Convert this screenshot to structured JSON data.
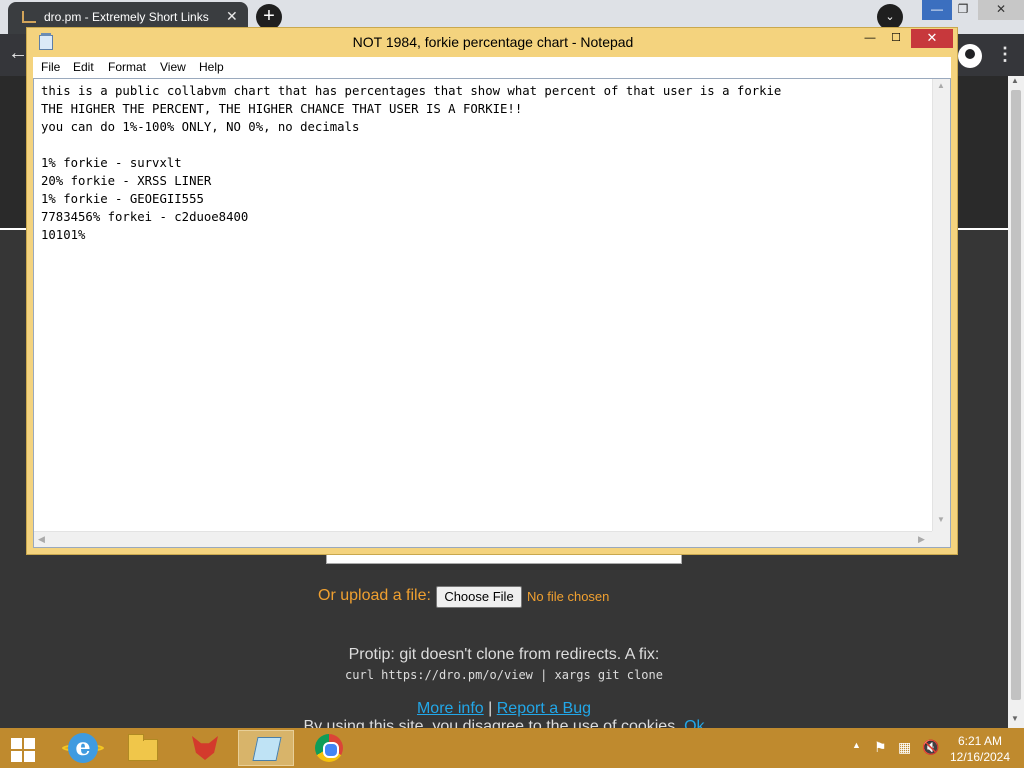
{
  "browser": {
    "tab_title": "dro.pm - Extremely Short Links",
    "tab_close": "✕",
    "new_tab": "+",
    "tab_search": "⌄",
    "minimize": "—",
    "restore": "❐",
    "close": "✕",
    "back": "←",
    "menu": "⋮"
  },
  "page": {
    "upload_label": "Or upload a file:",
    "choose_file": "Choose File",
    "no_file": "No file chosen",
    "protip": "Protip: git doesn't clone from redirects. A fix:",
    "protip_code": "curl https://dro.pm/o/view | xargs git clone",
    "more_info": "More info",
    "separator": "|",
    "report_bug": "Report a Bug",
    "cookie_text": "By using this site, you disagree to the use of cookies.",
    "cookie_ok": "Ok"
  },
  "notepad": {
    "title": "NOT 1984, forkie percentage chart - Notepad",
    "minimize": "—",
    "maximize": "☐",
    "close": "✕",
    "menu": [
      "File",
      "Edit",
      "Format",
      "View",
      "Help"
    ],
    "content": "this is a public collabvm chart that has percentages that show what percent of that user is a forkie\nTHE HIGHER THE PERCENT, THE HIGHER CHANCE THAT USER IS A FORKIE!!\nyou can do 1%-100% ONLY, NO 0%, no decimals\n\n1% forkie - survxlt\n20% forkie - XRSS LINER\n1% forkie - GEOEGII555\n7783456% forkei - c2duoe8400\n10101%"
  },
  "taskbar": {
    "clock_time": "6:21 AM",
    "clock_date": "12/16/2024",
    "tray_chevron": "▲"
  },
  "icons": {
    "browser_favicon": "dro-pm-favicon",
    "start": "windows-logo-icon",
    "ie": "internet-explorer-icon",
    "explorer": "file-explorer-icon",
    "fox": "red-fox-app-icon",
    "notepad": "notepad-icon",
    "chrome": "chrome-icon"
  },
  "colors": {
    "taskbar": "#bf8a2e",
    "notepad_frame": "#f4d37e",
    "accent_orange": "#f0a030",
    "link_blue": "#22a7e8",
    "close_red": "#c7383c"
  }
}
